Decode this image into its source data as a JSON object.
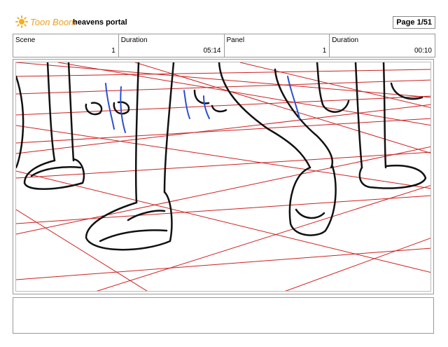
{
  "header": {
    "logo_text": "Toon Boom",
    "logo_icon": "sun-icon",
    "project_title": "heavens portal",
    "page_label": "Page",
    "page_value": "1/51"
  },
  "info": [
    {
      "label": "Scene",
      "value": "1"
    },
    {
      "label": "Duration",
      "value": "05:14"
    },
    {
      "label": "Panel",
      "value": "1"
    },
    {
      "label": "Duration",
      "value": "00:10"
    }
  ],
  "panel": {
    "grid_color": "#cc2020",
    "sketch_color": "#111111",
    "accent_color": "#2a4fd0"
  },
  "caption": {
    "text": ""
  }
}
